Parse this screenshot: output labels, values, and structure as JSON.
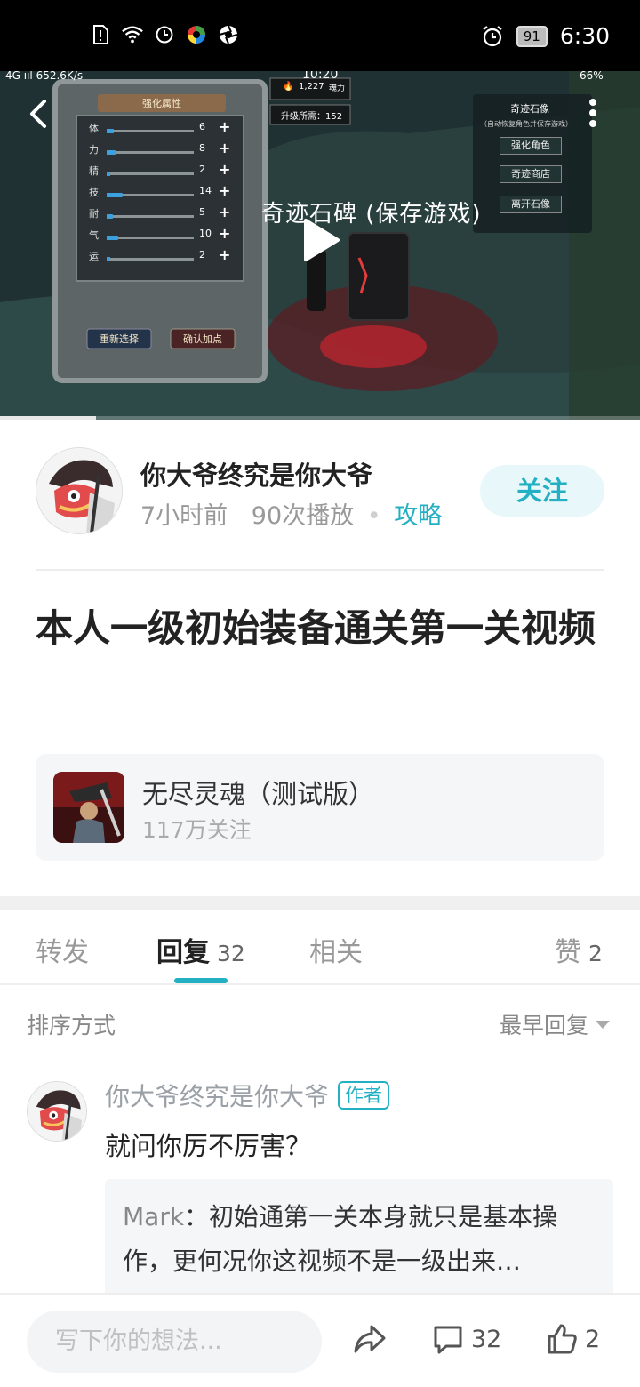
{
  "status_bar": {
    "time": "6:30",
    "battery": "91",
    "icons": [
      "sim-alert-icon",
      "wifi-icon",
      "clock-icon",
      "app-icon-colorwheel",
      "app-icon-aperture",
      "alarm-icon"
    ]
  },
  "video": {
    "overlay": {
      "speed": "4G ııl 652.6K/s",
      "time": "10:20",
      "battery": "66%",
      "fire_count": "1,227",
      "fire_unit": "魂力",
      "upgrade_label": "升级所需：152",
      "panel_title": "强化属性",
      "stats": [
        {
          "name": "体",
          "value": "6",
          "level": 0.08
        },
        {
          "name": "力",
          "value": "8",
          "level": 0.1
        },
        {
          "name": "精",
          "value": "2",
          "level": 0.03
        },
        {
          "name": "技",
          "value": "14",
          "level": 0.18
        },
        {
          "name": "耐",
          "value": "5",
          "level": 0.07
        },
        {
          "name": "气",
          "value": "10",
          "level": 0.13
        },
        {
          "name": "运",
          "value": "2",
          "level": 0.03
        }
      ],
      "reset_btn": "重新选择",
      "confirm_btn": "确认加点",
      "side_title": "奇迹石像",
      "side_sub": "（自动恢复角色并保存游戏）",
      "side_buttons": [
        "强化角色",
        "奇迹商店",
        "离开石像"
      ],
      "game_caption": "奇迹石碑 (保存游戏)"
    },
    "progress": 0.15
  },
  "author": {
    "name": "你大爷终究是你大爷",
    "time": "7小时前",
    "plays": "90次播放",
    "tag": "攻略",
    "follow": "关注"
  },
  "post": {
    "title": "本人一级初始装备通关第一关视频"
  },
  "game": {
    "name": "无尽灵魂（测试版）",
    "fans": "117万关注"
  },
  "tabs": {
    "forward": "转发",
    "reply": "回复",
    "reply_count": "32",
    "related": "相关",
    "like": "赞",
    "like_count": "2"
  },
  "sort": {
    "label": "排序方式",
    "value": "最早回复"
  },
  "comment": {
    "author": "你大爷终究是你大爷",
    "badge": "作者",
    "text": "就问你厉不厉害？",
    "quote_name": "Mark",
    "quote_text": "：初始通第一关本身就只是基本操作，更何况你这视频不是一级出来…"
  },
  "bottom": {
    "placeholder": "写下你的想法...",
    "comment_count": "32",
    "like_count": "2"
  }
}
